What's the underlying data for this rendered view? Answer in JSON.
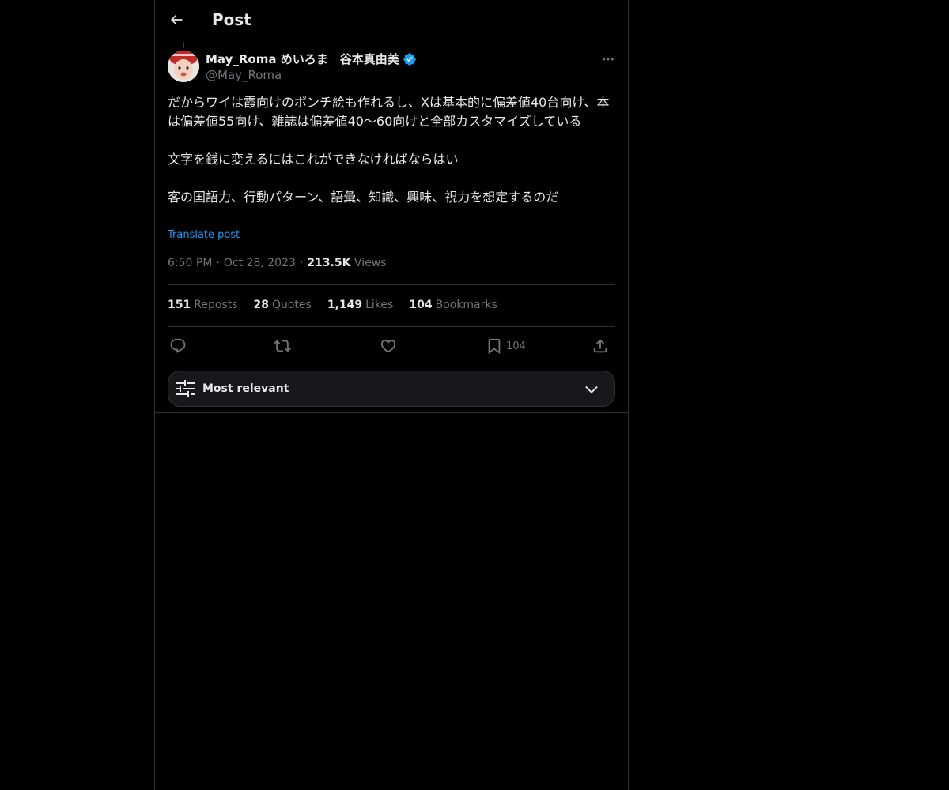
{
  "header": {
    "title": "Post"
  },
  "post": {
    "author": {
      "name": "May_Roma めいろま　谷本真由美",
      "handle": "@May_Roma",
      "verified": true
    },
    "text": {
      "p1": "だからワイは霞向けのポンチ絵も作れるし、Xは基本的に偏差値40台向け、本は偏差値55向け、雑誌は偏差値40〜60向けと全部カスタマイズしている",
      "p2": "文字を銭に変えるにはこれができなければならはい",
      "p3": "客の国語力、行動パターン、語彙、知識、興味、視力を想定するのだ"
    },
    "translate_label": "Translate post",
    "time": "6:50 PM",
    "date": "Oct 28, 2023",
    "views_count": "213.5K",
    "views_label": "Views",
    "stats": {
      "reposts_count": "151",
      "reposts_label": "Reposts",
      "quotes_count": "28",
      "quotes_label": "Quotes",
      "likes_count": "1,149",
      "likes_label": "Likes",
      "bookmarks_count": "104",
      "bookmarks_label": "Bookmarks"
    },
    "actions": {
      "reply_icon": "reply-icon",
      "repost_icon": "repost-icon",
      "like_icon": "heart-icon",
      "bookmark_icon": "bookmark-icon",
      "bookmark_count": "104",
      "share_icon": "share-icon"
    }
  },
  "replies_sort": {
    "label": "Most relevant",
    "icon": "sliders-icon"
  },
  "colors": {
    "background": "#000000",
    "text": "#e7e9ea",
    "muted": "#71767b",
    "accent": "#1d9bf0",
    "border": "#2f3336"
  }
}
